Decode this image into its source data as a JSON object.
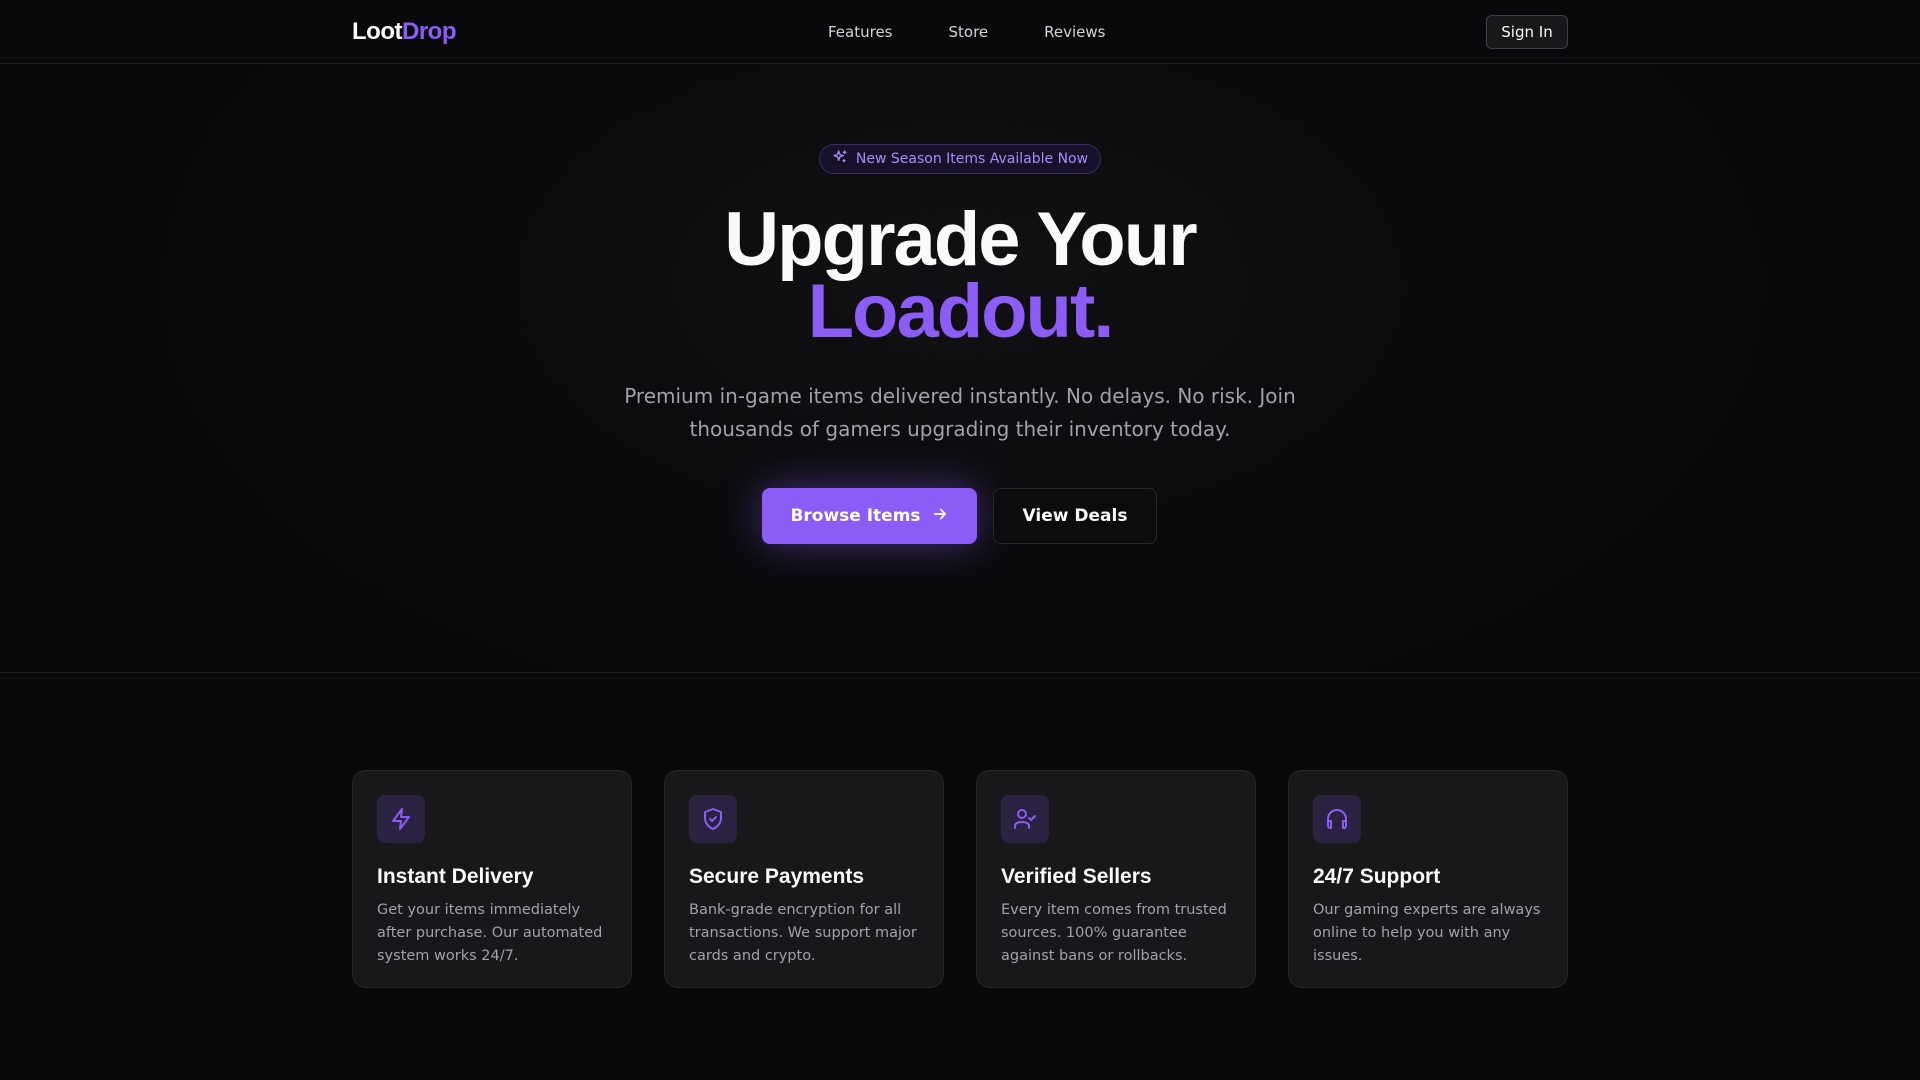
{
  "nav": {
    "logo_part1": "Loot",
    "logo_part2": "Drop",
    "links": [
      "Features",
      "Store",
      "Reviews"
    ],
    "signin_label": "Sign In"
  },
  "hero": {
    "badge_text": "New Season Items Available Now",
    "title_line1": "Upgrade Your",
    "title_line2": "Loadout.",
    "subtitle": "Premium in-game items delivered instantly. No delays. No risk. Join thousands of gamers upgrading their inventory today.",
    "primary_cta": "Browse Items",
    "secondary_cta": "View Deals"
  },
  "features": [
    {
      "icon": "lightning-icon",
      "title": "Instant Delivery",
      "desc": "Get your items immediately after purchase. Our automated system works 24/7."
    },
    {
      "icon": "shield-check-icon",
      "title": "Secure Payments",
      "desc": "Bank-grade encryption for all transactions. We support major cards and crypto."
    },
    {
      "icon": "user-check-icon",
      "title": "Verified Sellers",
      "desc": "Every item comes from trusted sources. 100% guarantee against bans or rollbacks."
    },
    {
      "icon": "headphones-icon",
      "title": "24/7 Support",
      "desc": "Our gaming experts are always online to help you with any issues."
    }
  ],
  "colors": {
    "accent": "#8b5cf6",
    "background": "#09090b",
    "card": "#18181b",
    "muted_text": "#a1a1aa"
  }
}
